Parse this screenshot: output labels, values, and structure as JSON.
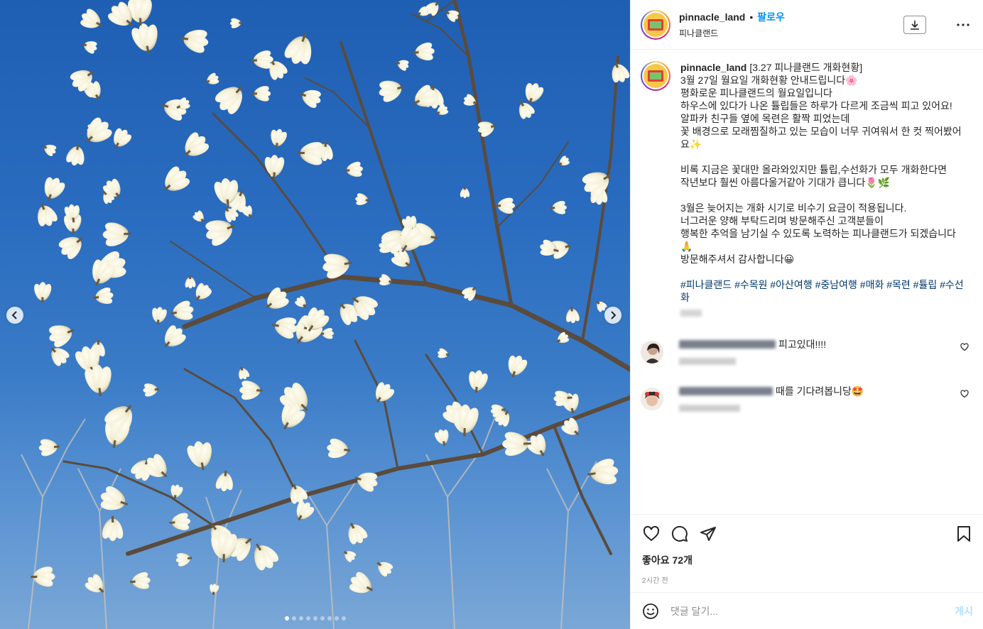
{
  "header": {
    "username": "pinnacle_land",
    "bullet": "•",
    "follow_label": "팔로우",
    "location": "피나클랜드"
  },
  "caption": {
    "username": "pinnacle_land",
    "text": "[3.27 피나클랜드 개화현황]\n3월 27일 월요일 개화현황 안내드립니다🌸\n평화로운 피나클랜드의 월요일입니다\n하우스에 있다가 나온 튤립들은 하루가 다르게 조금씩 피고 있어요!\n알파카 친구들 옆에 목련은 활짝 피었는데\n꽃 배경으로 모래찜질하고 있는 모습이 너무 귀여워서 한 컷 찍어봤어요✨\n\n비록 지금은 꽃대만 올라와있지만 튤립,수선화가 모두 개화한다면\n작년보다 훨씬 아름다울거같아 기대가 큽니다🌷🌿\n\n3월은 늦어지는 개화 시기로 비수기 요금이 적용됩니다.\n너그러운 양해 부탁드리며 방문해주신 고객분들이\n행복한 추억을 남기실 수 있도록 노력하는 피나클랜드가 되겠습니다🙏\n방문해주셔서 감사합니다😀",
    "hashtags": "#피나클랜드 #수목원 #아산여행 #중남여행 #매화 #목련 #튤립 #수선화"
  },
  "comments": [
    {
      "text": "피고있대!!!!"
    },
    {
      "text": "때를 기다려봅니당🤩"
    }
  ],
  "likes": "좋아요 72개",
  "time_ago": "2시간 전",
  "add_comment": {
    "placeholder": "댓글 달기...",
    "post_label": "게시"
  },
  "carousel": {
    "dot_count": 9,
    "active_index": 0
  },
  "icons": {
    "download": "download-icon",
    "more": "more-options-icon",
    "like": "heart-icon",
    "comment": "comment-icon",
    "share": "share-icon",
    "save": "bookmark-icon",
    "emoji": "emoji-icon",
    "prev": "chevron-left-icon",
    "next": "chevron-right-icon"
  },
  "colors": {
    "follow": "#0095f6",
    "hashtag": "#00376b",
    "post_disabled": "#b2dffc",
    "sky": "#2a6cbf"
  }
}
